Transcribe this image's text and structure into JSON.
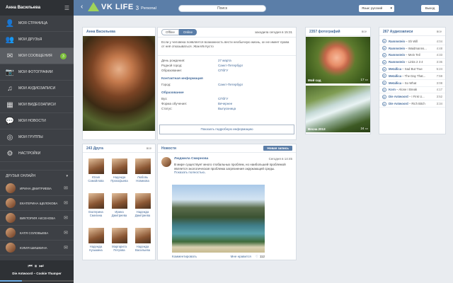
{
  "sidebar": {
    "user_name": "Анна Васильева",
    "menu": [
      {
        "label": "Моя страница",
        "icon": "user-icon"
      },
      {
        "label": "Мои друзья",
        "icon": "users-icon"
      },
      {
        "label": "Мои сообщения",
        "icon": "envelope-icon",
        "badge": "3",
        "active": true
      },
      {
        "label": "Мои фотографии",
        "icon": "camera-icon"
      },
      {
        "label": "Мои аудиозаписи",
        "icon": "music-note-icon"
      },
      {
        "label": "Мои видеозаписи",
        "icon": "film-icon"
      },
      {
        "label": "Мои новости",
        "icon": "chat-bubble-icon"
      },
      {
        "label": "Мои группы",
        "icon": "globe-icon"
      },
      {
        "label": "Настройки",
        "icon": "gear-icon"
      }
    ],
    "online_header": "Друзья онлайн",
    "online_friends": [
      "Ирина Дмитриева",
      "Екатерина Щелокова",
      "Виктория Аксенова",
      "Катя Соловьева",
      "Юлия Шишкина"
    ],
    "player": {
      "track": "Die Antwoord – Cookie Thumper",
      "progress": 0.3
    }
  },
  "topbar": {
    "logo_text": "VK LIFE",
    "logo_version": "3",
    "logo_edition": "Personal",
    "search_placeholder": "Поиск",
    "language": "Язык: русский",
    "logout": "Выход"
  },
  "profile": {
    "name": "Анна Васильева"
  },
  "info": {
    "toggle_off": "Offline",
    "toggle_on": "Online",
    "last_seen": "заходила сегодня в 15:31",
    "status": "Если у человека появляется возможность вести необычную жизнь, он не имеет права от неё отказываться. Жак-Ив Кусто",
    "basic": [
      {
        "k": "День рождения:",
        "v": "27 марта"
      },
      {
        "k": "Родной город:",
        "v": "Санкт-Петербург"
      },
      {
        "k": "Образование:",
        "v": "СПбГУ"
      }
    ],
    "contact_title": "Контактная информация",
    "contact": [
      {
        "k": "Город:",
        "v": "Санкт-Петербург"
      }
    ],
    "edu_title": "Образование",
    "edu": [
      {
        "k": "Вуз:",
        "v": "СПбГУ"
      },
      {
        "k": "Форма обучения:",
        "v": "Вечернее"
      },
      {
        "k": "Статус:",
        "v": "Выпускница"
      }
    ],
    "more_button": "Показать подробную информацию"
  },
  "photos": {
    "title": "2357 фотографий",
    "all": "все",
    "items": [
      {
        "caption": "Мой сад",
        "comments": "17"
      },
      {
        "caption": "Весна 2013",
        "comments": "24"
      }
    ]
  },
  "audio": {
    "title": "267 Аудиозаписи",
    "all": "все",
    "tracks": [
      {
        "artist": "Rammstein",
        "title": "Sh Will",
        "dur": "4:04"
      },
      {
        "artist": "Rammstein",
        "title": "Waidmanns...",
        "dur": "4:48"
      },
      {
        "artist": "Rammstein",
        "title": "Mein Teil",
        "dur": "4:33"
      },
      {
        "artist": "Rammstein",
        "title": "Links 2 3 4",
        "dur": "3:36"
      },
      {
        "artist": "Metallica",
        "title": "Sad But True",
        "dur": "5:24"
      },
      {
        "artist": "Metallica",
        "title": "The Day That...",
        "dur": "7:59"
      },
      {
        "artist": "Metallica",
        "title": "So What",
        "dur": "3:08"
      },
      {
        "artist": "Korn",
        "title": "Alone I Break",
        "dur": "4:17"
      },
      {
        "artist": "Die Antwoord",
        "title": "I Fink U...",
        "dur": "3:52"
      },
      {
        "artist": "Die Antwoord",
        "title": "Rich Bitch",
        "dur": "3:34"
      }
    ]
  },
  "friends": {
    "title": "243 Друга",
    "all": "все",
    "items": [
      {
        "first": "Юлия",
        "last": "Самойлова"
      },
      {
        "first": "Надежда",
        "last": "Прокофьева"
      },
      {
        "first": "Любовь",
        "last": "Новикова"
      },
      {
        "first": "Екатерина",
        "last": "Смелина"
      },
      {
        "first": "Ирина",
        "last": "Дмитриева"
      },
      {
        "first": "Надежда",
        "last": "Дмитриева"
      },
      {
        "first": "Надежда",
        "last": "Кузьмина"
      },
      {
        "first": "Маргарита",
        "last": "Петрова"
      },
      {
        "first": "Надежда",
        "last": "Васильева"
      }
    ]
  },
  "news": {
    "title": "Новости",
    "new_post": "Новая запись",
    "post": {
      "author": "Людмила Смирнова",
      "date": "Сегодня в 14:45",
      "text": "В мире существует много глобальных проблем, но наибольшей проблемой является экологическая проблема загрязнения окружающей среды.",
      "show_more": "Показать полностью..",
      "comment": "Комментировать",
      "likes_label": "Мне нравится",
      "likes": "112"
    }
  }
}
